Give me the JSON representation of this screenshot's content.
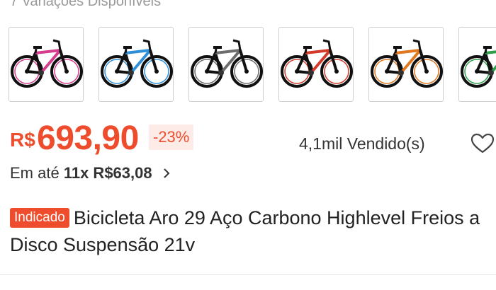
{
  "variants": {
    "label": "7 Variações Disponíveis",
    "items": [
      {
        "name": "bike-pink",
        "accent": "#d43c8e"
      },
      {
        "name": "bike-blue",
        "accent": "#2f8fd8"
      },
      {
        "name": "bike-gray",
        "accent": "#6d6d6d"
      },
      {
        "name": "bike-red",
        "accent": "#d23a2a"
      },
      {
        "name": "bike-orange",
        "accent": "#e0781f"
      },
      {
        "name": "bike-green",
        "accent": "#2e9e4a"
      }
    ]
  },
  "price": {
    "currency": "R$",
    "value": "693,90",
    "discount": "-23%",
    "color": "#ee4d2d"
  },
  "sales": {
    "sold": "4,1mil Vendido(s)",
    "favorite_icon": "heart-icon"
  },
  "installments": {
    "prefix": "Em até",
    "value": "11x R$63,08",
    "icon": "chevron-right-icon"
  },
  "product": {
    "badge": "Indicado",
    "title": "Bicicleta Aro 29 Aço Carbono Highlevel Freios a Disco Suspensão 21v"
  }
}
